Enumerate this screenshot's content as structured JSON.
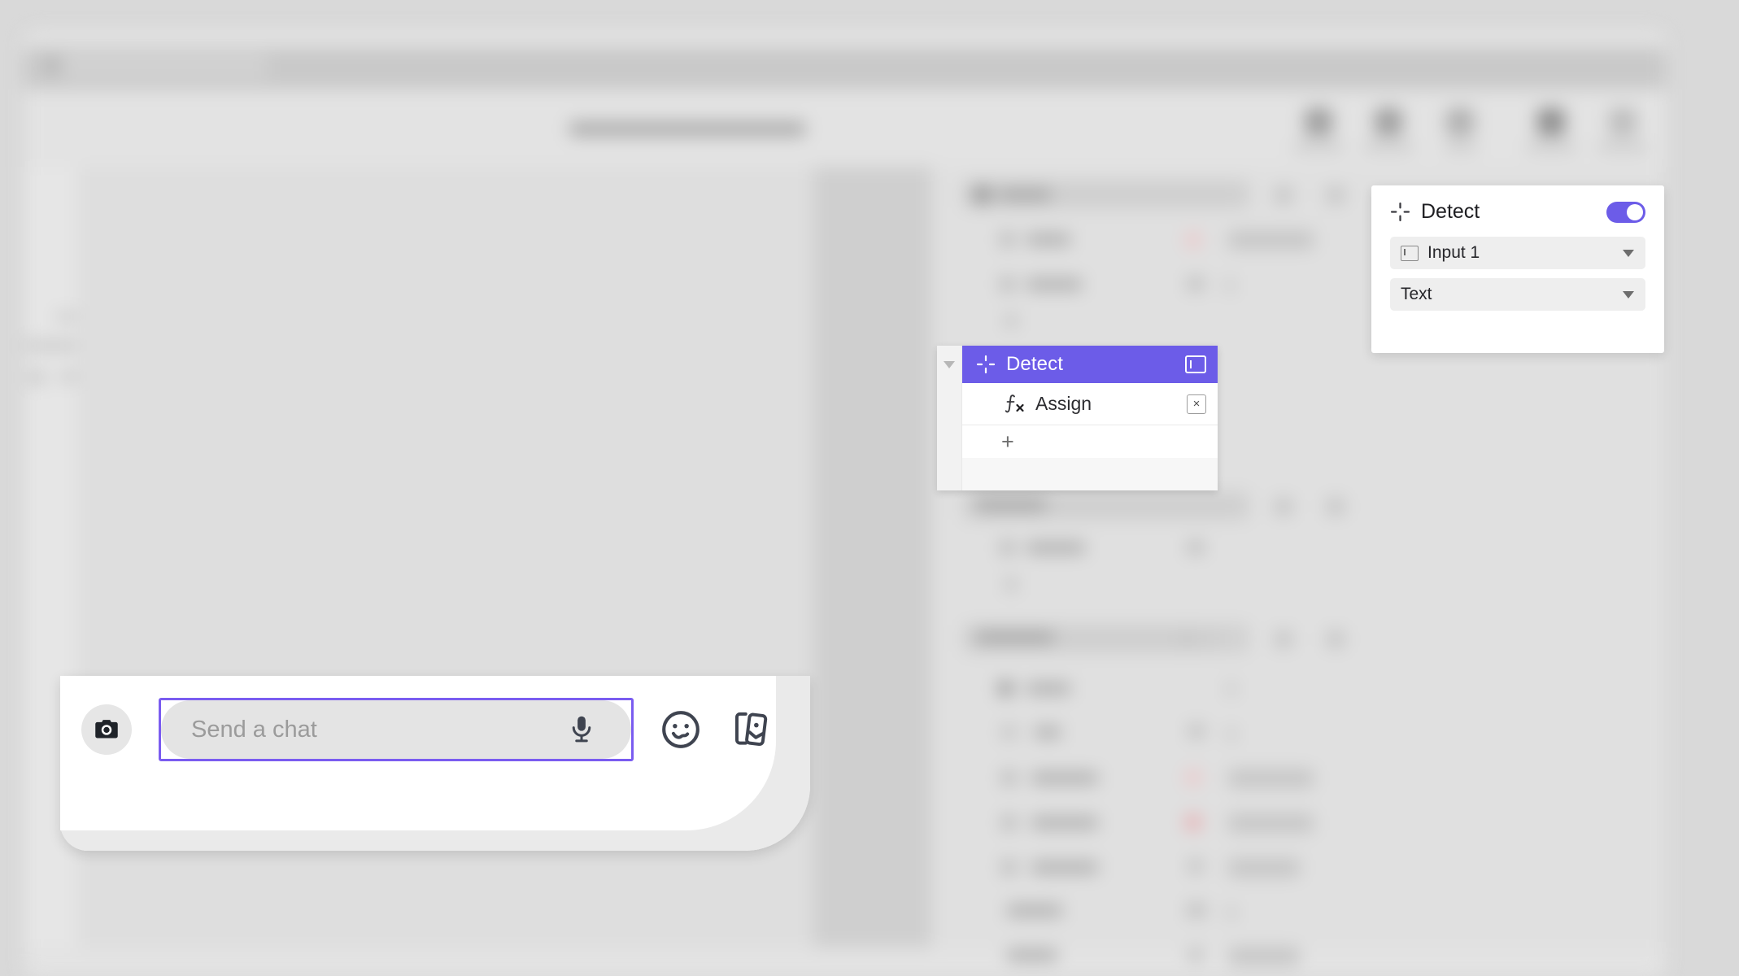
{
  "window": {
    "title_placeholder": "",
    "toolbar_icon_names": [
      "toolbar-icon-1",
      "toolbar-icon-2",
      "toolbar-icon-3",
      "toolbar-icon-4",
      "toolbar-icon-5"
    ]
  },
  "colors": {
    "accent_purple": "#6C5CE8",
    "focus_purple": "#7A5CF0",
    "panel_white": "#FFFFFF",
    "page_background": "#D9D9D9",
    "select_background": "#EEEEEE",
    "pink_status": "#E8A9AD"
  },
  "tree_node": {
    "title": "Detect",
    "icon": "detect-crosshair-icon",
    "port_icon": "input-port-icon",
    "collapse_icon": "caret-down-icon",
    "children": [
      {
        "label": "Assign",
        "icon": "function-fx-icon",
        "action_icon": "close-x-icon",
        "action_label": "×"
      }
    ],
    "add_label": "+"
  },
  "properties_panel": {
    "title": "Detect",
    "icon": "detect-crosshair-icon",
    "toggle": {
      "name": "detect-enabled-toggle",
      "state": "on"
    },
    "fields": [
      {
        "name": "input-select",
        "icon": "input-port-icon",
        "value": "Input 1",
        "caret": "chevron-down-icon"
      },
      {
        "name": "type-select",
        "icon": null,
        "value": "Text",
        "caret": "chevron-down-icon"
      }
    ]
  },
  "chat_bar": {
    "camera_button_label": "camera-icon",
    "input": {
      "value": "",
      "placeholder": "Send a chat"
    },
    "mic_icon": "microphone-icon",
    "emoji_icon": "smiley-face-icon",
    "sticker_icon": "stickers-cards-icon"
  }
}
